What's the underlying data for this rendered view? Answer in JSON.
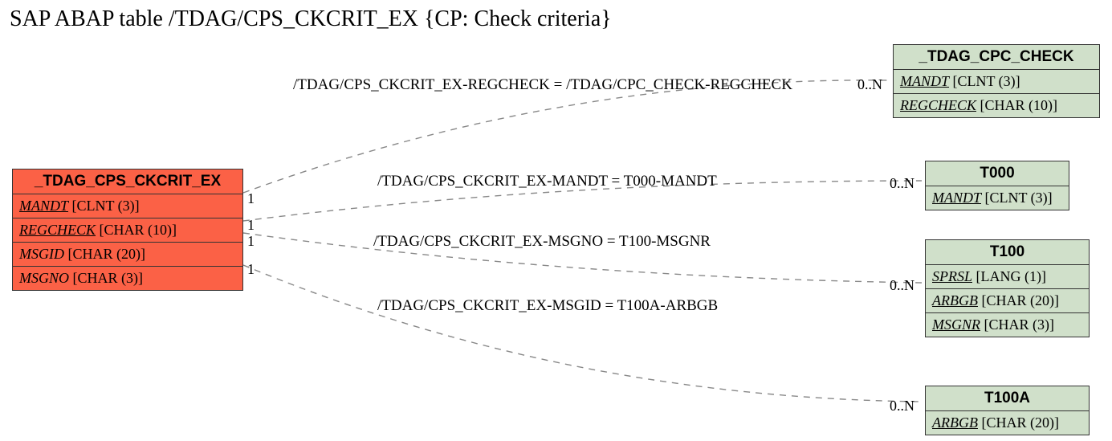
{
  "title": "SAP ABAP table /TDAG/CPS_CKCRIT_EX {CP: Check criteria}",
  "main": {
    "name": "_TDAG_CPS_CKCRIT_EX",
    "fields": [
      {
        "fname": "MANDT",
        "ftype": " [CLNT (3)]",
        "key": true
      },
      {
        "fname": "REGCHECK",
        "ftype": " [CHAR (10)]",
        "key": true
      },
      {
        "fname": "MSGID",
        "ftype": " [CHAR (20)]",
        "key": false
      },
      {
        "fname": "MSGNO",
        "ftype": " [CHAR (3)]",
        "key": false
      }
    ]
  },
  "refs": {
    "cpc_check": {
      "name": "_TDAG_CPC_CHECK",
      "fields": [
        {
          "fname": "MANDT",
          "ftype": " [CLNT (3)]",
          "key": true
        },
        {
          "fname": "REGCHECK",
          "ftype": " [CHAR (10)]",
          "key": true
        }
      ]
    },
    "t000": {
      "name": "T000",
      "fields": [
        {
          "fname": "MANDT",
          "ftype": " [CLNT (3)]",
          "key": true
        }
      ]
    },
    "t100": {
      "name": "T100",
      "fields": [
        {
          "fname": "SPRSL",
          "ftype": " [LANG (1)]",
          "key": true
        },
        {
          "fname": "ARBGB",
          "ftype": " [CHAR (20)]",
          "key": true
        },
        {
          "fname": "MSGNR",
          "ftype": " [CHAR (3)]",
          "key": true
        }
      ]
    },
    "t100a": {
      "name": "T100A",
      "fields": [
        {
          "fname": "ARBGB",
          "ftype": " [CHAR (20)]",
          "key": true
        }
      ]
    }
  },
  "rels": {
    "regcheck": "/TDAG/CPS_CKCRIT_EX-REGCHECK = /TDAG/CPC_CHECK-REGCHECK",
    "mandt": "/TDAG/CPS_CKCRIT_EX-MANDT = T000-MANDT",
    "msgno": "/TDAG/CPS_CKCRIT_EX-MSGNO = T100-MSGNR",
    "msgid": "/TDAG/CPS_CKCRIT_EX-MSGID = T100A-ARBGB"
  },
  "card": {
    "one": "1",
    "many": "0..N"
  }
}
